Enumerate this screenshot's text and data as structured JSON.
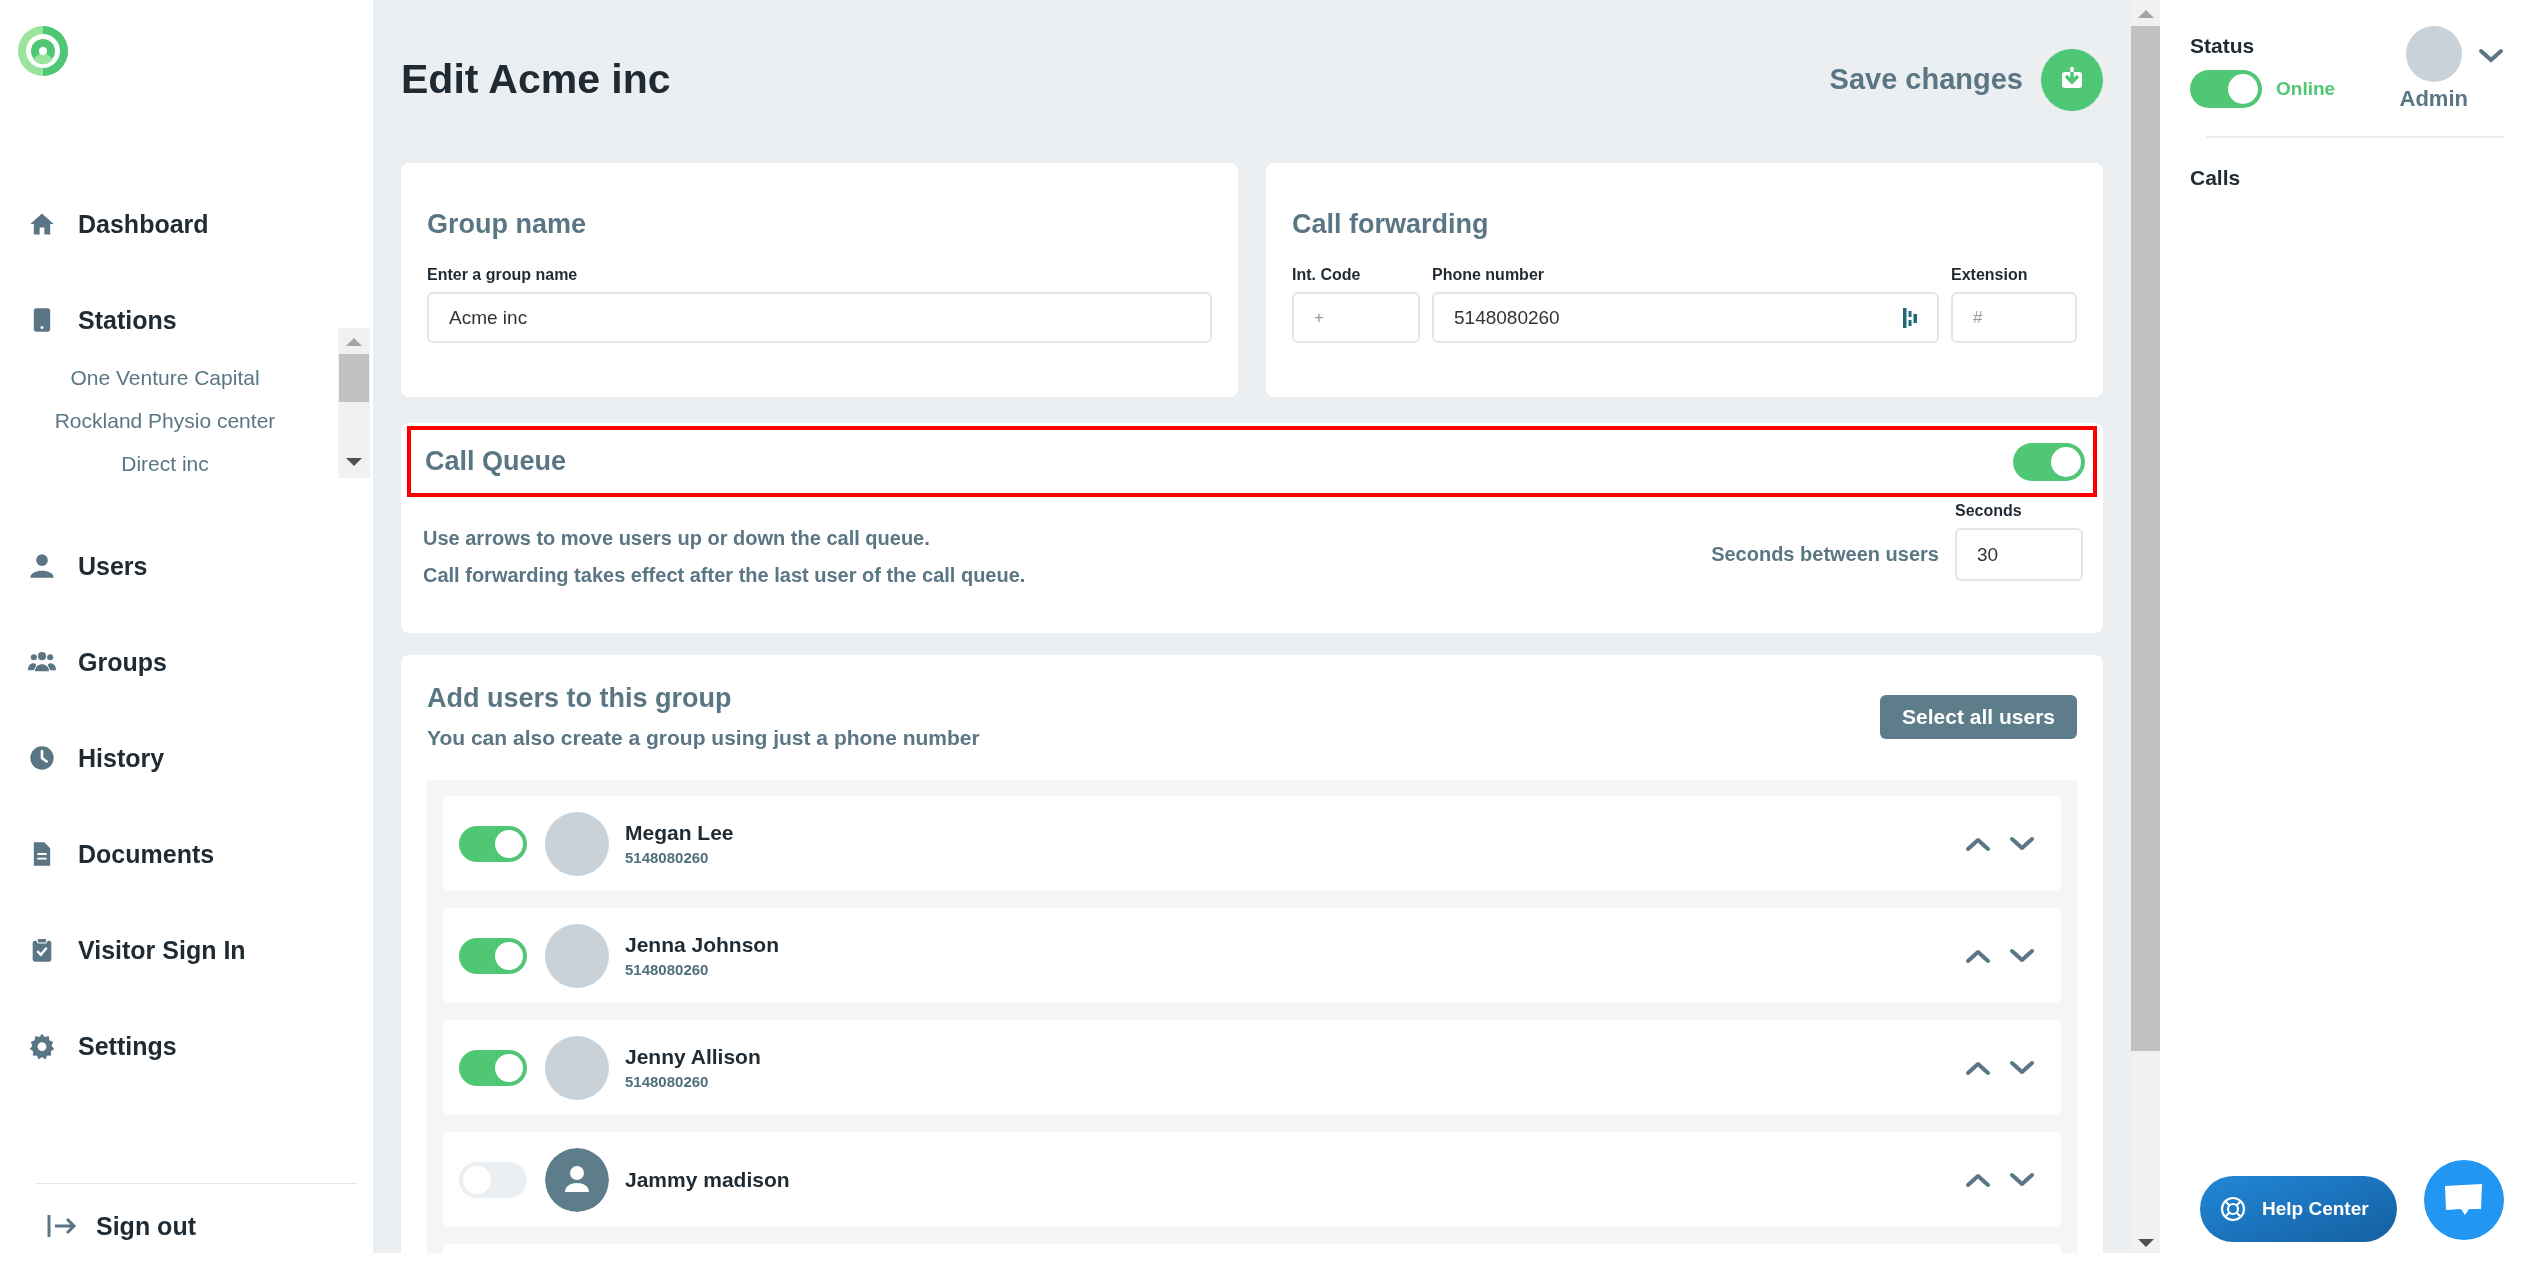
{
  "sidebar": {
    "nav": [
      {
        "label": "Dashboard"
      },
      {
        "label": "Stations",
        "children": [
          {
            "label": "One Venture Capital"
          },
          {
            "label": "Rockland Physio center"
          },
          {
            "label": "Direct inc"
          }
        ]
      },
      {
        "label": "Users"
      },
      {
        "label": "Groups"
      },
      {
        "label": "History"
      },
      {
        "label": "Documents"
      },
      {
        "label": "Visitor Sign In"
      },
      {
        "label": "Settings"
      }
    ],
    "sign_out": "Sign out"
  },
  "header": {
    "title": "Edit Acme inc",
    "save_label": "Save changes"
  },
  "group_card": {
    "title": "Group name",
    "field_label": "Enter a group name",
    "value": "Acme inc"
  },
  "forwarding_card": {
    "title": "Call forwarding",
    "fields": [
      {
        "label": "Int. Code",
        "placeholder": "+"
      },
      {
        "label": "Phone number",
        "value": "5148080260"
      },
      {
        "label": "Extension",
        "placeholder": "#"
      }
    ]
  },
  "call_queue": {
    "title": "Call Queue",
    "on": true,
    "lines": [
      "Use arrows to move users up or down the call queue.",
      "Call forwarding takes effect after the last user of the call queue."
    ],
    "seconds_text": "Seconds between users",
    "seconds_label": "Seconds",
    "seconds_value": "30"
  },
  "users_card": {
    "title": "Add users to this group",
    "subtitle": "You can also create a group using just a phone number",
    "select_all": "Select all users",
    "users": [
      {
        "name": "Megan Lee",
        "phone": "5148080260",
        "on": true,
        "kind": "photo"
      },
      {
        "name": "Jenna Johnson",
        "phone": "5148080260",
        "on": true,
        "kind": "photo"
      },
      {
        "name": "Jenny Allison",
        "phone": "5148080260",
        "on": true,
        "kind": "photo"
      },
      {
        "name": "Jammy madison",
        "on": false,
        "kind": "default"
      }
    ]
  },
  "right_panel": {
    "status_label": "Status",
    "status_on": true,
    "status_text": "Online",
    "user_name": "Admin",
    "calls_label": "Calls"
  },
  "help_button": "Help Center"
}
